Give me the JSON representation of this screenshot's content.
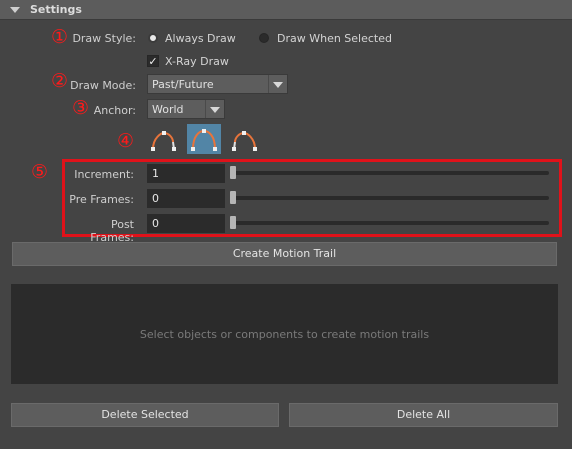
{
  "section": {
    "title": "Settings"
  },
  "markers": [
    "①",
    "②",
    "③",
    "④",
    "⑤"
  ],
  "draw_style": {
    "label": "Draw Style:",
    "options": [
      "Always Draw",
      "Draw When Selected"
    ],
    "selected": "Always Draw"
  },
  "xray": {
    "label": "X-Ray Draw",
    "checked": true
  },
  "draw_mode": {
    "label": "Draw Mode:",
    "value": "Past/Future"
  },
  "anchor": {
    "label": "Anchor:",
    "value": "World"
  },
  "trail_icons": [
    "trail-left-icon",
    "trail-center-icon",
    "trail-right-icon"
  ],
  "fields": {
    "increment": {
      "label": "Increment:",
      "value": "1"
    },
    "pre_frames": {
      "label": "Pre Frames:",
      "value": "0"
    },
    "post_frames": {
      "label": "Post Frames:",
      "value": "0"
    }
  },
  "buttons": {
    "create": "Create Motion Trail",
    "delete_selected": "Delete Selected",
    "delete_all": "Delete All"
  },
  "list": {
    "placeholder": "Select objects or components to create motion trails"
  },
  "colors": {
    "highlight": "#e0121a",
    "selected_icon_bg": "#5285a6",
    "trail_arc": "#e8743b"
  }
}
